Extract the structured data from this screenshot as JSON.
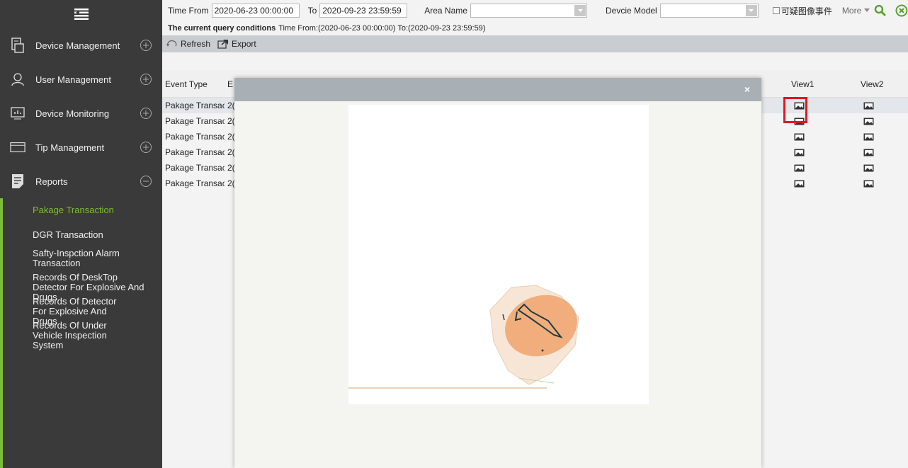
{
  "sidebar": {
    "menu": [
      {
        "label": "Device Management",
        "icon": "device-icon",
        "expanded": false
      },
      {
        "label": "User Management",
        "icon": "user-icon",
        "expanded": false
      },
      {
        "label": "Device Monitoring",
        "icon": "monitoring-icon",
        "expanded": false
      },
      {
        "label": "Tip Management",
        "icon": "tip-icon",
        "expanded": false
      },
      {
        "label": "Reports",
        "icon": "report-icon",
        "expanded": true
      }
    ],
    "submenu": [
      {
        "label": "Pakage Transaction",
        "active": true
      },
      {
        "label": "DGR Transaction",
        "active": false
      },
      {
        "label": "Safty-Inspction Alarm Transaction",
        "active": false
      },
      {
        "label": "Records Of DeskTop Detector For Explosive And Drugs",
        "active": false
      },
      {
        "label": "Records Of Detector For Explosive And Drugs",
        "active": false
      },
      {
        "label": "Records Of Under Vehicle Inspection System",
        "active": false
      }
    ],
    "active_color": "#7cbc3a"
  },
  "filters": {
    "time_from_label": "Time From",
    "time_from_value": "2020-06-23 00:00:00",
    "to_label": "To",
    "to_value": "2020-09-23 23:59:59",
    "area_label": "Area Name",
    "area_value": "",
    "model_label": "Devcie Model",
    "model_value": "",
    "checkbox_label": "可疑图像事件",
    "more_label": "More"
  },
  "query": {
    "label": "The current query conditions",
    "text": "Time From:(2020-06-23 00:00:00)  To:(2020-09-23 23:59:59)"
  },
  "toolbar": {
    "refresh_label": "Refresh",
    "export_label": "Export"
  },
  "table": {
    "headers": [
      "Event Type",
      "E",
      "View1",
      "View2"
    ],
    "rows": [
      {
        "event_type": "Pakage Transac",
        "e": "2("
      },
      {
        "event_type": "Pakage Transac",
        "e": "2("
      },
      {
        "event_type": "Pakage Transac",
        "e": "2("
      },
      {
        "event_type": "Pakage Transac",
        "e": "2("
      },
      {
        "event_type": "Pakage Transac",
        "e": "2("
      },
      {
        "event_type": "Pakage Transac",
        "e": "2("
      }
    ]
  },
  "modal": {
    "close_label": "×"
  }
}
